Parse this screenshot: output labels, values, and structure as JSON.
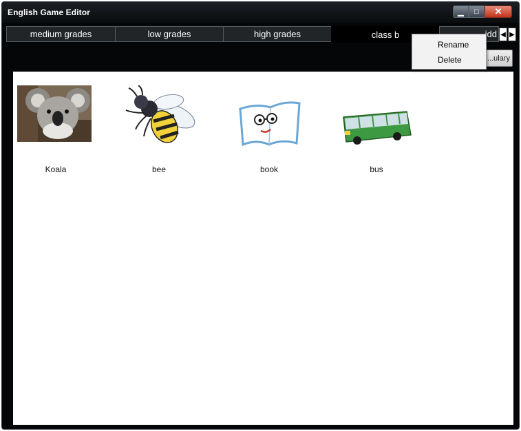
{
  "window": {
    "title": "English Game Editor"
  },
  "tabs": [
    {
      "label": "medium grades",
      "active": false
    },
    {
      "label": "low grades",
      "active": false
    },
    {
      "label": "high grades",
      "active": false
    },
    {
      "label": "class b",
      "active": true
    },
    {
      "label": "...idd",
      "active": false
    }
  ],
  "toolbar": {
    "add_vocabulary_label": "...ulary"
  },
  "items": [
    {
      "label": "Koala",
      "icon": "koala-image"
    },
    {
      "label": "bee",
      "icon": "bee-image"
    },
    {
      "label": "book",
      "icon": "book-image"
    },
    {
      "label": "bus",
      "icon": "bus-image"
    }
  ],
  "context_menu": {
    "items": [
      {
        "label": "Rename"
      },
      {
        "label": "Delete"
      }
    ]
  },
  "colors": {
    "window_bg": "#050607",
    "close_button": "#c3321c",
    "content_bg": "#ffffff"
  }
}
